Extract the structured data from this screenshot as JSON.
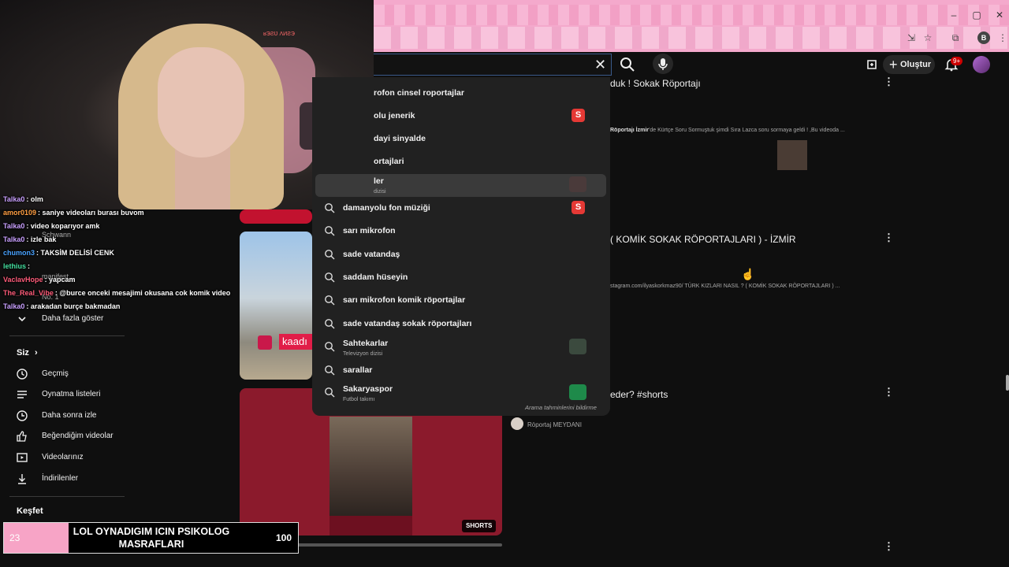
{
  "browser": {
    "window_controls": [
      "–",
      "▢",
      "✕"
    ],
    "profile_letter": "B"
  },
  "header": {
    "create_label": "Oluştur",
    "notif_count": "9+"
  },
  "webcam": {
    "watermark": "ʁЭƧƲ ɅИƧЭ"
  },
  "chat": [
    {
      "user": "Talka0",
      "msg": "olm",
      "color": "#c9a0ff"
    },
    {
      "user": "amor0109",
      "msg": "saniye videoları burası buvom",
      "color": "#ff9f43"
    },
    {
      "user": "Talka0",
      "msg": "video koparıyor amk",
      "color": "#c9a0ff"
    },
    {
      "user": "Talka0",
      "msg": "izle bak",
      "color": "#c9a0ff"
    },
    {
      "user": "chumon3",
      "msg": "TAKSİM DELİSİ CENK",
      "color": "#4aa3ff"
    },
    {
      "user": "lethius",
      "msg": "",
      "color": "#45e0a0"
    },
    {
      "user": "VaclavHope",
      "msg": "yapcam",
      "color": "#ff5c7a"
    },
    {
      "user": "The_Real_Vibe",
      "msg": "@burce onceki mesajimi okusana cok komik video",
      "color": "#ff5c7a"
    },
    {
      "user": "Talka0",
      "msg": "arakadan burçe bakmadan",
      "color": "#c9a0ff"
    }
  ],
  "sidebar": {
    "ghost_labels": [
      "Schwann",
      "manifest",
      "No. 1"
    ],
    "show_more": "Daha fazla göster",
    "you_heading": "Siz",
    "you_items": [
      {
        "label": "Geçmiş",
        "icon": "history-icon"
      },
      {
        "label": "Oynatma listeleri",
        "icon": "playlist-icon"
      },
      {
        "label": "Daha sonra izle",
        "icon": "clock-icon"
      },
      {
        "label": "Beğendiğim videolar",
        "icon": "thumbs-up-icon"
      },
      {
        "label": "Videolarınız",
        "icon": "video-icon"
      },
      {
        "label": "İndirilenler",
        "icon": "download-icon"
      }
    ],
    "explore_heading": "Keşfet"
  },
  "thumbnails": {
    "thumb2_text": "kaadı",
    "shorts_badge": "SHORTS"
  },
  "results": [
    {
      "title": "duk ! Sokak Röportajı",
      "desc_html": ""
    },
    {
      "title": "( KOMİK SOKAK RÖPORTAJLARI ) - İZMİR",
      "desc": "stagram.com/ilyaskorkmaz90/ TÜRK KIZLARI NASIL ? ( KOMİK SOKAK RÖPORTAJLARI ) ..."
    },
    {
      "title": "eder? #shorts",
      "channel": "Röportaj MEYDANI"
    }
  ],
  "result1_desc_prefix": "Röportajı İzmir",
  "result1_desc": "'de Kürtçe Soru Sormuştuk şimdi Sıra Lazca soru sormaya geldi ! ,Bu videoda ...",
  "suggestions": [
    {
      "text": "rofon cinsel roportajlar",
      "sub": ""
    },
    {
      "text": "olu jenerik",
      "sub": "",
      "logo": "S"
    },
    {
      "text": "dayi sinyalde",
      "sub": ""
    },
    {
      "text": "ortajlari",
      "sub": ""
    },
    {
      "text": "ler",
      "sub": "dizisi",
      "thumb": "#4a3a3a"
    },
    {
      "text": "damanyolu fon müziği",
      "sub": "",
      "logo": "S"
    },
    {
      "text": "sarı mikrofon",
      "sub": ""
    },
    {
      "text": "sade vatandaş",
      "sub": ""
    },
    {
      "text": "saddam hüseyin",
      "sub": ""
    },
    {
      "text": "sarı mikrofon komik röportajlar",
      "sub": ""
    },
    {
      "text": "sade vatandaş sokak röportajları",
      "sub": ""
    },
    {
      "text": "Sahtekarlar",
      "sub": "Televizyon dizisi",
      "thumb": "#3b4a3e"
    },
    {
      "text": "sarallar",
      "sub": ""
    },
    {
      "text": "Sakaryaspor",
      "sub": "Futbol takımı",
      "thumb": "#1e8a4a"
    }
  ],
  "report_label": "Arama tahminlerini bildirme",
  "banner": {
    "left": "23",
    "title": "LOL OYNADIGIM ICIN PSIKOLOG MASRAFLARI",
    "right": "100"
  },
  "colors": {
    "brand_pink": "#f4a9cc",
    "bg": "#0f0f0f",
    "dropdown_bg": "#212121",
    "shorts_red": "#8b1a2c"
  }
}
